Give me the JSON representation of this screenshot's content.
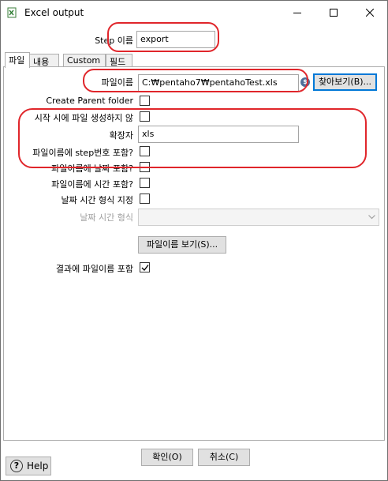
{
  "window": {
    "title": "Excel output"
  },
  "step": {
    "label": "Step 이름",
    "value": "export"
  },
  "tabs": [
    {
      "label": "파일"
    },
    {
      "label": "내용"
    },
    {
      "label": "Custom"
    },
    {
      "label": "필드"
    }
  ],
  "file": {
    "filename_label": "파일이름",
    "filename_value": "C:₩pentaho7₩pentahoTest.xls",
    "browse_label": "찾아보기(B)...",
    "create_parent_label": "Create Parent folder",
    "create_parent_checked": false,
    "no_create_label": "시작 시에 파일 생성하지 않",
    "no_create_checked": false,
    "extension_label": "확장자",
    "extension_value": "xls",
    "include_stepnr_label": "파일이름에 step번호 포함?",
    "include_stepnr_checked": false,
    "include_date_label": "파일이름에 날짜 포함?",
    "include_date_checked": false,
    "include_time_label": "파일이름에 시간 포함?",
    "include_time_checked": false,
    "specify_format_label": "날짜 시간 형식 지정",
    "specify_format_checked": false,
    "date_format_label": "날짜 시간 형식",
    "date_format_value": "",
    "show_filename_label": "파일이름 보기(S)...",
    "add_to_result_label": "결과에 파일이름 포함",
    "add_to_result_checked": true
  },
  "buttons": {
    "ok": "확인(O)",
    "cancel": "취소(C)",
    "help": "Help"
  },
  "icons": {
    "variable": "$",
    "help": "?"
  },
  "colors": {
    "annotation": "#e0262b",
    "focus": "#0078d7"
  }
}
